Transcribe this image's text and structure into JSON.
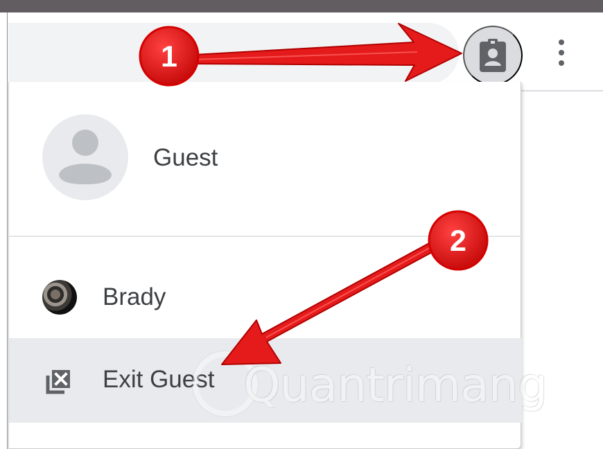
{
  "profile_menu": {
    "current_profile": {
      "name": "Guest",
      "avatar_icon": "default-person-icon"
    },
    "other_profiles": [
      {
        "name": "Brady",
        "avatar": "profile-photo"
      }
    ],
    "exit_guest_label": "Exit Guest",
    "exit_icon": "exit-guest-icon"
  },
  "toolbar": {
    "profile_button_icon": "guest-profile-badge-icon",
    "menu_icon": "more-vertical-icon"
  },
  "callouts": {
    "step_one": "1",
    "step_two": "2",
    "color": "#e61d1d"
  },
  "watermark": {
    "text": "Quantrimang"
  },
  "colors": {
    "panel_background": "#ffffff",
    "hover_row": "#e8eaed",
    "text": "#3c4043",
    "icon_gray": "#5f6368",
    "profile_button": "#dadce0"
  }
}
